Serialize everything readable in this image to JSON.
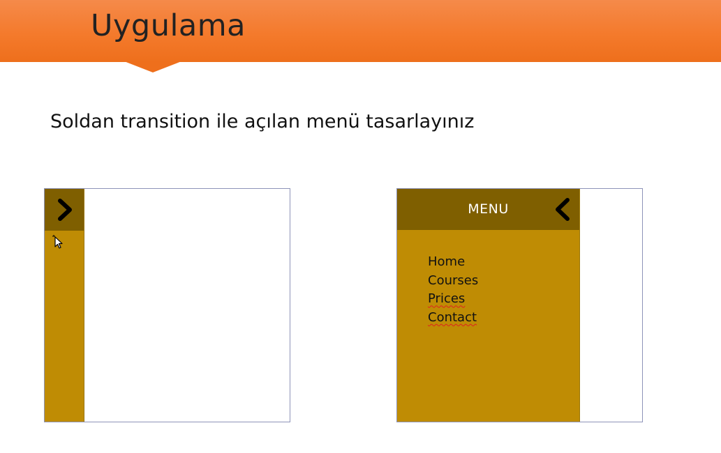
{
  "slide": {
    "title": "Uygulama",
    "instruction": "Soldan transition ile açılan menü tasarlayınız"
  },
  "mockup_collapsed": {
    "toggle_icon": "chevron-right-icon",
    "cursor_icon": "move-cursor-icon"
  },
  "mockup_expanded": {
    "menu_title": "MENU",
    "toggle_icon": "chevron-left-icon",
    "items": [
      "Home",
      "Courses",
      "Prices",
      "Contact"
    ]
  },
  "colors": {
    "header_orange": "#f47a2c",
    "panel_gold": "#bf8c04",
    "panel_header_brown": "#7f5f00",
    "frame_border": "#8d93b8"
  }
}
